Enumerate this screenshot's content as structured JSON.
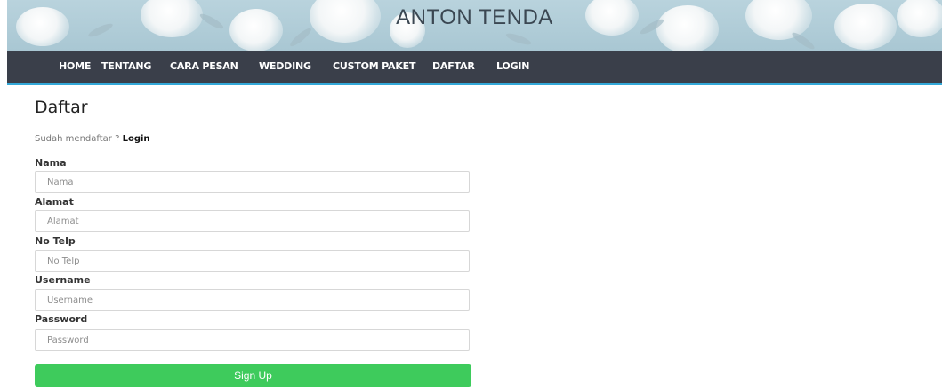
{
  "header": {
    "brand": "ANTON TENDA"
  },
  "nav": {
    "items": [
      {
        "label": "HOME"
      },
      {
        "label": "TENTANG"
      },
      {
        "label": "CARA PESAN"
      },
      {
        "label": "WEDDING"
      },
      {
        "label": "CUSTOM PAKET"
      },
      {
        "label": "DAFTAR"
      },
      {
        "label": "LOGIN"
      }
    ]
  },
  "form": {
    "title": "Daftar",
    "login_prompt": "Sudah mendaftar ?",
    "login_link": "Login",
    "fields": [
      {
        "label": "Nama",
        "placeholder": "Nama",
        "value": ""
      },
      {
        "label": "Alamat",
        "placeholder": "Alamat",
        "value": ""
      },
      {
        "label": "No Telp",
        "placeholder": "No Telp",
        "value": ""
      },
      {
        "label": "Username",
        "placeholder": "Username",
        "value": ""
      },
      {
        "label": "Password",
        "placeholder": "Password",
        "value": ""
      }
    ],
    "submit_label": "Sign Up"
  },
  "colors": {
    "navbar": "#3a3f4a",
    "navbar_accent": "#33a8d8",
    "submit": "#3ecb5c",
    "banner": "#b9d3dd"
  }
}
